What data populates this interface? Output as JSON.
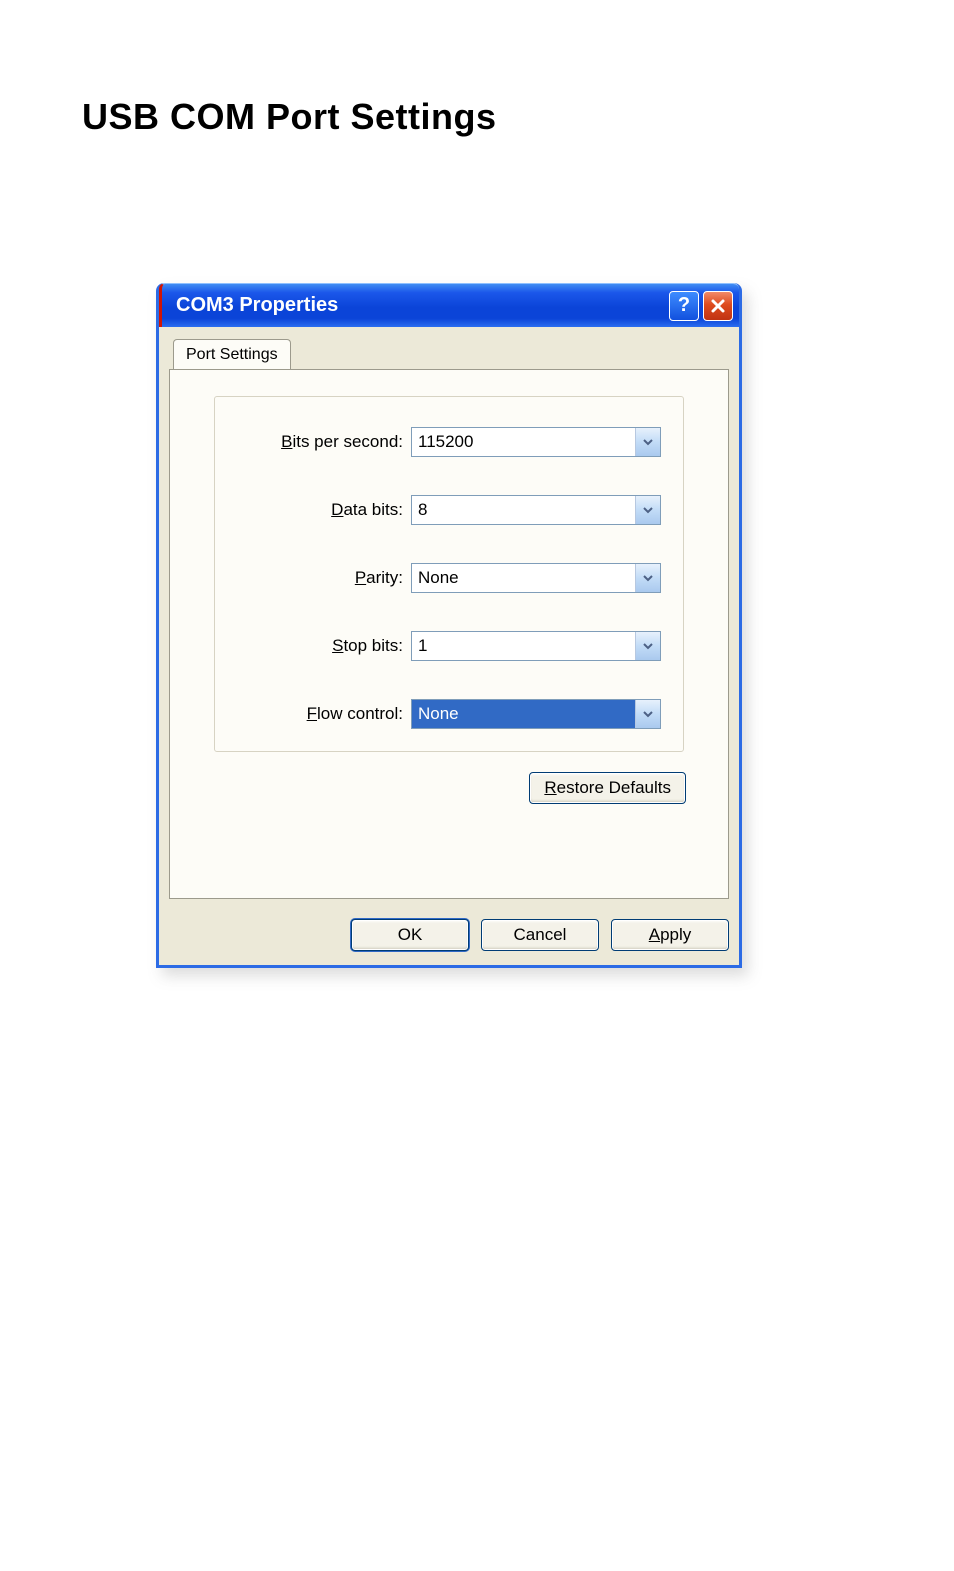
{
  "page": {
    "heading": "USB COM Port Settings"
  },
  "dialog": {
    "title": "COM3 Properties",
    "help_tooltip": "Help",
    "close_tooltip": "Close"
  },
  "tabs": {
    "port_settings": "Port Settings"
  },
  "fields": {
    "bits_per_second": {
      "label": "Bits per second:",
      "value": "115200"
    },
    "data_bits": {
      "label": "Data bits:",
      "value": "8"
    },
    "parity": {
      "label": "Parity:",
      "value": "None"
    },
    "stop_bits": {
      "label": "Stop bits:",
      "value": "1"
    },
    "flow_control": {
      "label": "Flow control:",
      "value": "None",
      "selected": true
    }
  },
  "buttons": {
    "restore_defaults": "Restore Defaults",
    "ok": "OK",
    "cancel": "Cancel",
    "apply": "Apply"
  },
  "colors": {
    "xp_blue_titlebar": "#0b44d8",
    "xp_face": "#ece9d8",
    "xp_select": "#316ac5",
    "border_blue": "#0046d5"
  }
}
